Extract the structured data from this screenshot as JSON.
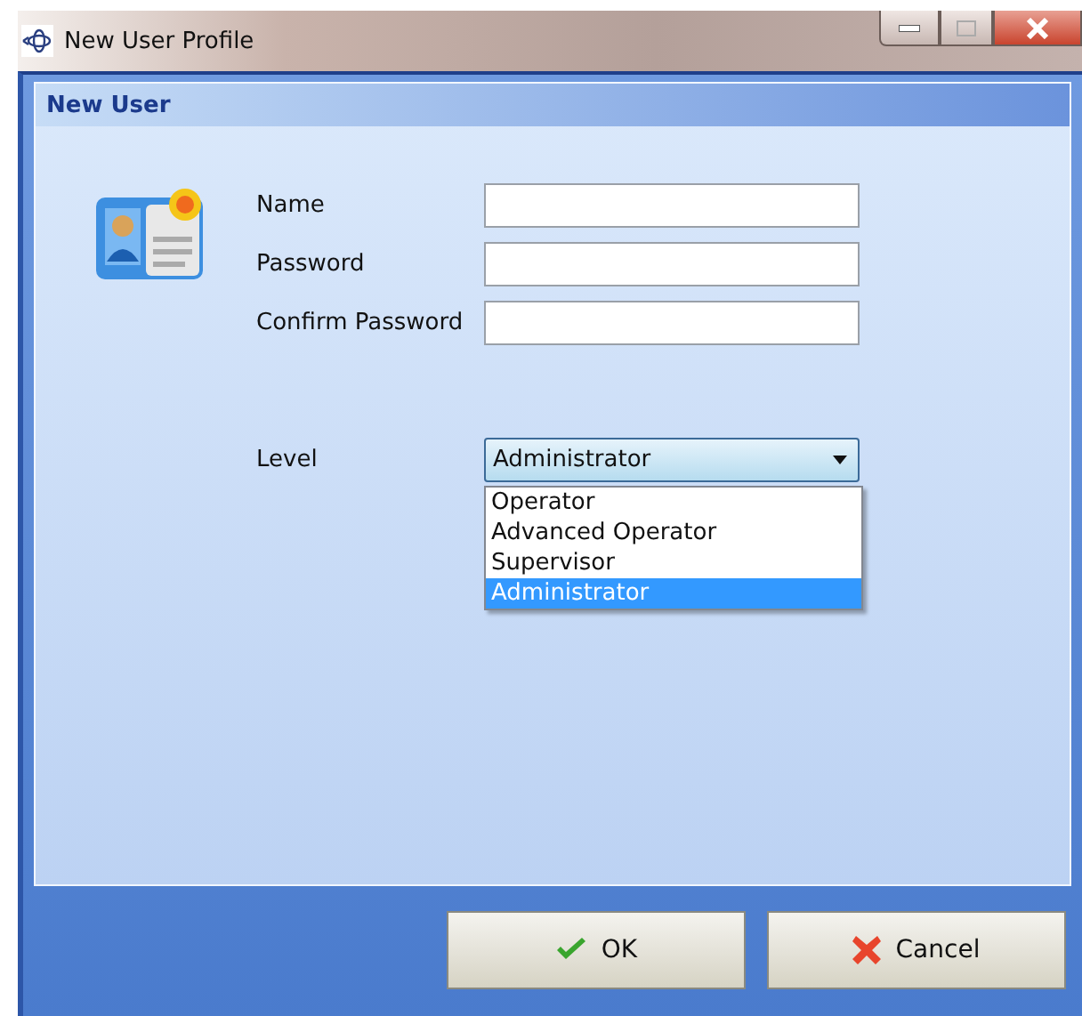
{
  "window": {
    "title": "New User Profile"
  },
  "panel": {
    "title": "New User"
  },
  "fields": [
    {
      "label": "Name",
      "kind": "text"
    },
    {
      "label": "Password",
      "kind": "password"
    },
    {
      "label": "Confirm Password",
      "kind": "password"
    },
    {
      "label": "Level",
      "kind": "select",
      "value": "Administrator",
      "expanded": true
    }
  ],
  "level_options": [
    {
      "label": "Operator",
      "selected": false
    },
    {
      "label": "Advanced Operator",
      "selected": false
    },
    {
      "label": "Supervisor",
      "selected": false
    },
    {
      "label": "Administrator",
      "selected": true
    }
  ],
  "buttons": [
    {
      "label": "OK",
      "kind": "ok"
    },
    {
      "label": "Cancel",
      "kind": "cancel"
    }
  ]
}
